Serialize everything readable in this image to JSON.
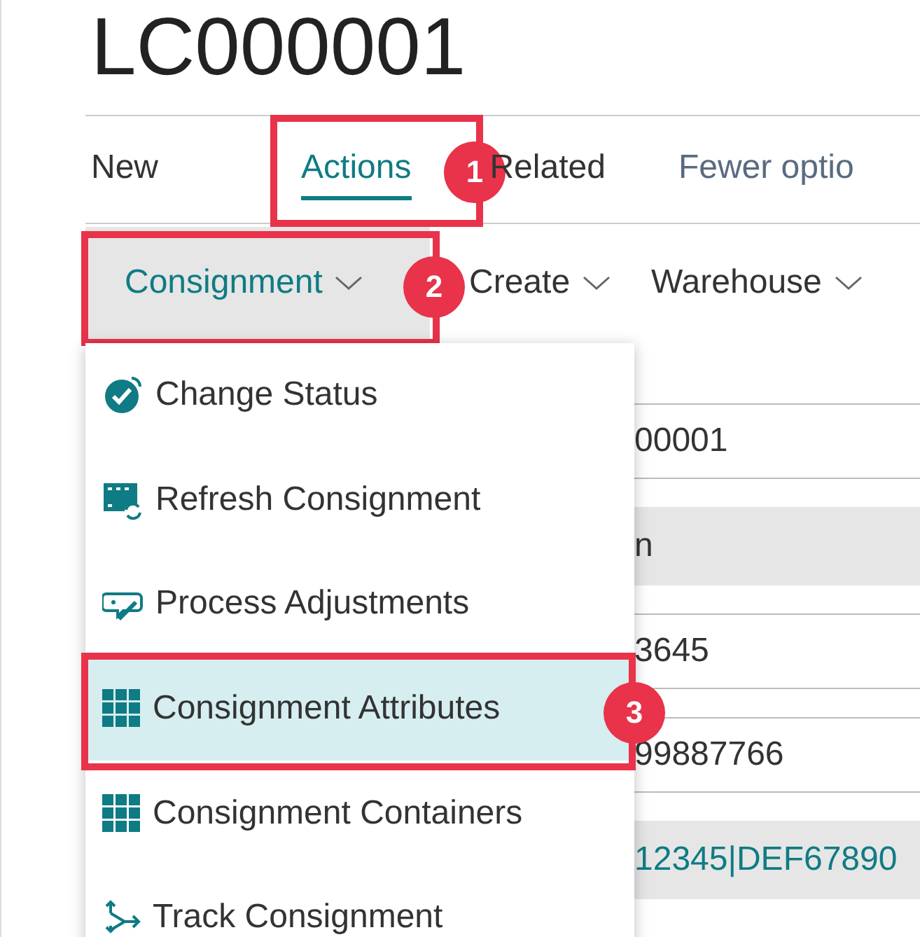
{
  "page_title": "LC000001",
  "tabs": [
    {
      "label": "New",
      "selected": false
    },
    {
      "label": "Actions",
      "selected": true,
      "step": "1"
    },
    {
      "label": "Related",
      "selected": false
    },
    {
      "label": "Fewer optio",
      "selected": false,
      "kind": "more"
    }
  ],
  "action_groups": [
    {
      "label": "Consignment",
      "selected": true,
      "step": "2"
    },
    {
      "label": "Create",
      "selected": false
    },
    {
      "label": "Warehouse",
      "selected": false
    }
  ],
  "menu_items": [
    {
      "label": "Change Status",
      "kind": "status",
      "selected": false
    },
    {
      "label": "Refresh Consignment",
      "kind": "refresh",
      "selected": false
    },
    {
      "label": "Process Adjustments",
      "kind": "adjust",
      "selected": false
    },
    {
      "label": "Consignment Attributes",
      "kind": "grid",
      "selected": true,
      "step": "3"
    },
    {
      "label": "Consignment Containers",
      "kind": "grid",
      "selected": false
    },
    {
      "label": "Track Consignment",
      "kind": "track",
      "selected": false
    }
  ],
  "fields": [
    {
      "value": "00001",
      "kind": "input"
    },
    {
      "value": "n",
      "kind": "readonly"
    },
    {
      "value": "3645",
      "kind": "input"
    },
    {
      "value": "99887766",
      "kind": "input"
    },
    {
      "value": "12345|DEF67890",
      "kind": "link"
    }
  ]
}
